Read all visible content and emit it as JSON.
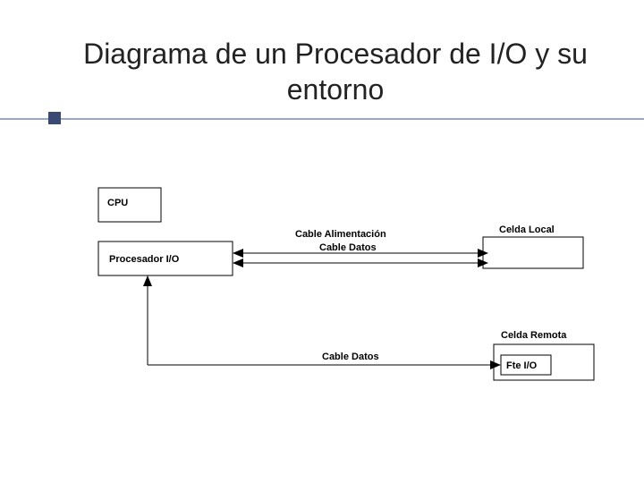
{
  "title": "Diagrama de un Procesador de I/O y su entorno",
  "boxes": {
    "cpu": "CPU",
    "processor": "Procesador   I/O",
    "local_cell": "Celda Local",
    "remote_cell": "Celda Remota",
    "fte": "Fte I/O"
  },
  "labels": {
    "power_cable": "Cable Alimentación",
    "data_cable_top": "Cable Datos",
    "data_cable_bottom": "Cable Datos"
  }
}
